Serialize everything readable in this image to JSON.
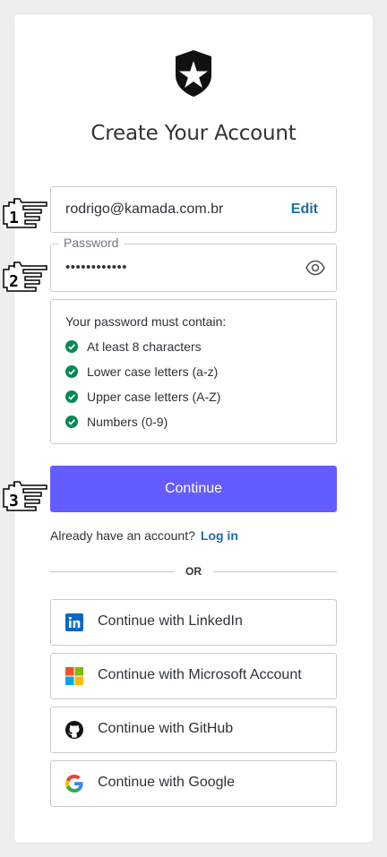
{
  "header": {
    "title": "Create Your Account",
    "logo_icon": "auth0-star-shield-icon"
  },
  "email": {
    "value": "rodrigo@kamada.com.br",
    "edit_label": "Edit"
  },
  "password": {
    "label": "Password",
    "masked_value": "••••••••••••",
    "toggle_icon": "eye-icon"
  },
  "rules": {
    "title": "Your password must contain:",
    "items": [
      "At least 8 characters",
      "Lower case letters (a-z)",
      "Upper case letters (A-Z)",
      "Numbers (0-9)"
    ]
  },
  "continue_label": "Continue",
  "login_prompt": {
    "text": "Already have an account?",
    "link": "Log in"
  },
  "divider_label": "OR",
  "social": [
    {
      "label": "Continue with LinkedIn",
      "icon": "linkedin-icon"
    },
    {
      "label": "Continue with Microsoft Account",
      "icon": "microsoft-icon"
    },
    {
      "label": "Continue with GitHub",
      "icon": "github-icon"
    },
    {
      "label": "Continue with Google",
      "icon": "google-icon"
    }
  ],
  "annotations": [
    "1",
    "2",
    "3"
  ],
  "colors": {
    "accent": "#635dff",
    "link": "#1f6d9e",
    "check": "#0a8754",
    "background": "#eeeef0"
  }
}
